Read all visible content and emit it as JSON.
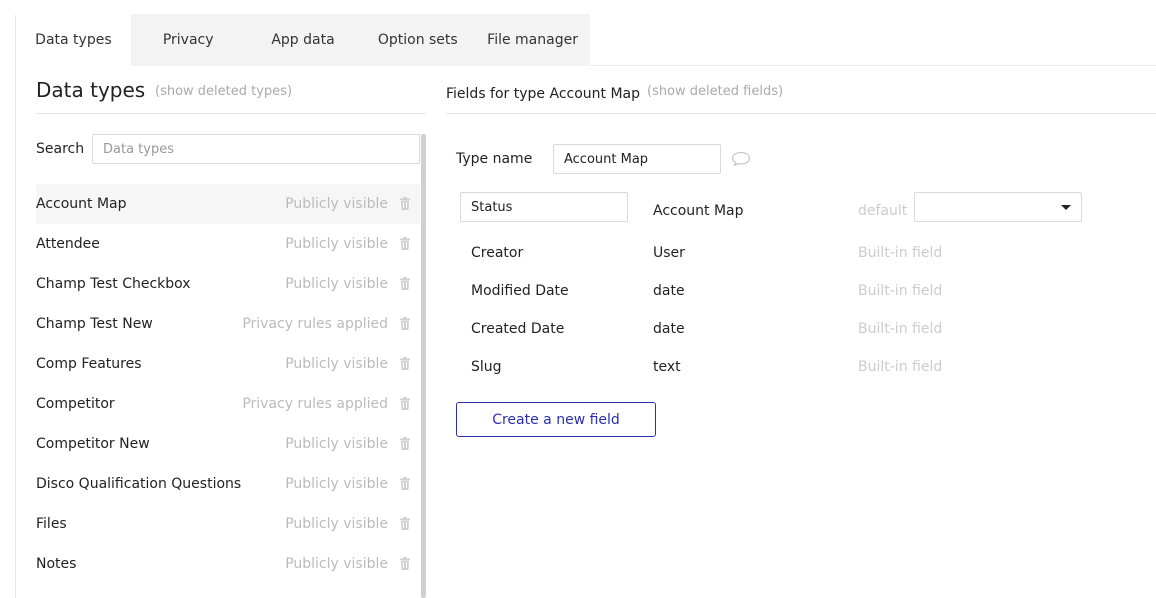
{
  "tabs": [
    {
      "label": "Data types",
      "active": true
    },
    {
      "label": "Privacy",
      "active": false
    },
    {
      "label": "App data",
      "active": false
    },
    {
      "label": "Option sets",
      "active": false
    },
    {
      "label": "File manager",
      "active": false
    }
  ],
  "data_types_panel": {
    "title": "Data types",
    "show_deleted": "(show deleted types)",
    "search_label": "Search",
    "search_placeholder": "Data types",
    "search_value": "",
    "items": [
      {
        "name": "Account Map",
        "privacy": "Publicly visible",
        "selected": true
      },
      {
        "name": "Attendee",
        "privacy": "Publicly visible",
        "selected": false
      },
      {
        "name": "Champ Test Checkbox",
        "privacy": "Publicly visible",
        "selected": false
      },
      {
        "name": "Champ Test New",
        "privacy": "Privacy rules applied",
        "selected": false
      },
      {
        "name": "Comp Features",
        "privacy": "Publicly visible",
        "selected": false
      },
      {
        "name": "Competitor",
        "privacy": "Privacy rules applied",
        "selected": false
      },
      {
        "name": "Competitor New",
        "privacy": "Publicly visible",
        "selected": false
      },
      {
        "name": "Disco Qualification Questions",
        "privacy": "Publicly visible",
        "selected": false
      },
      {
        "name": "Files",
        "privacy": "Publicly visible",
        "selected": false
      },
      {
        "name": "Notes",
        "privacy": "Publicly visible",
        "selected": false
      }
    ]
  },
  "fields_panel": {
    "title": "Fields for type Account Map",
    "show_deleted": "(show deleted fields)",
    "type_name_label": "Type name",
    "type_name_value": "Account Map",
    "fields": [
      {
        "name": "Status",
        "type": "Account Map",
        "meta": "default",
        "editable": true,
        "default_value": ""
      },
      {
        "name": "Creator",
        "type": "User",
        "meta": "Built-in field",
        "editable": false
      },
      {
        "name": "Modified Date",
        "type": "date",
        "meta": "Built-in field",
        "editable": false
      },
      {
        "name": "Created Date",
        "type": "date",
        "meta": "Built-in field",
        "editable": false
      },
      {
        "name": "Slug",
        "type": "text",
        "meta": "Built-in field",
        "editable": false
      }
    ],
    "create_button_label": "Create a new field"
  },
  "icons": {
    "trash": "trash-icon",
    "comment": "comment-icon",
    "dropdown": "caret-down-icon"
  },
  "colors": {
    "accent": "#2a2fb0",
    "muted_text": "#bbbbbb",
    "tab_bar_bg": "#f3f3f3",
    "selected_row_bg": "#f6f6f6"
  }
}
